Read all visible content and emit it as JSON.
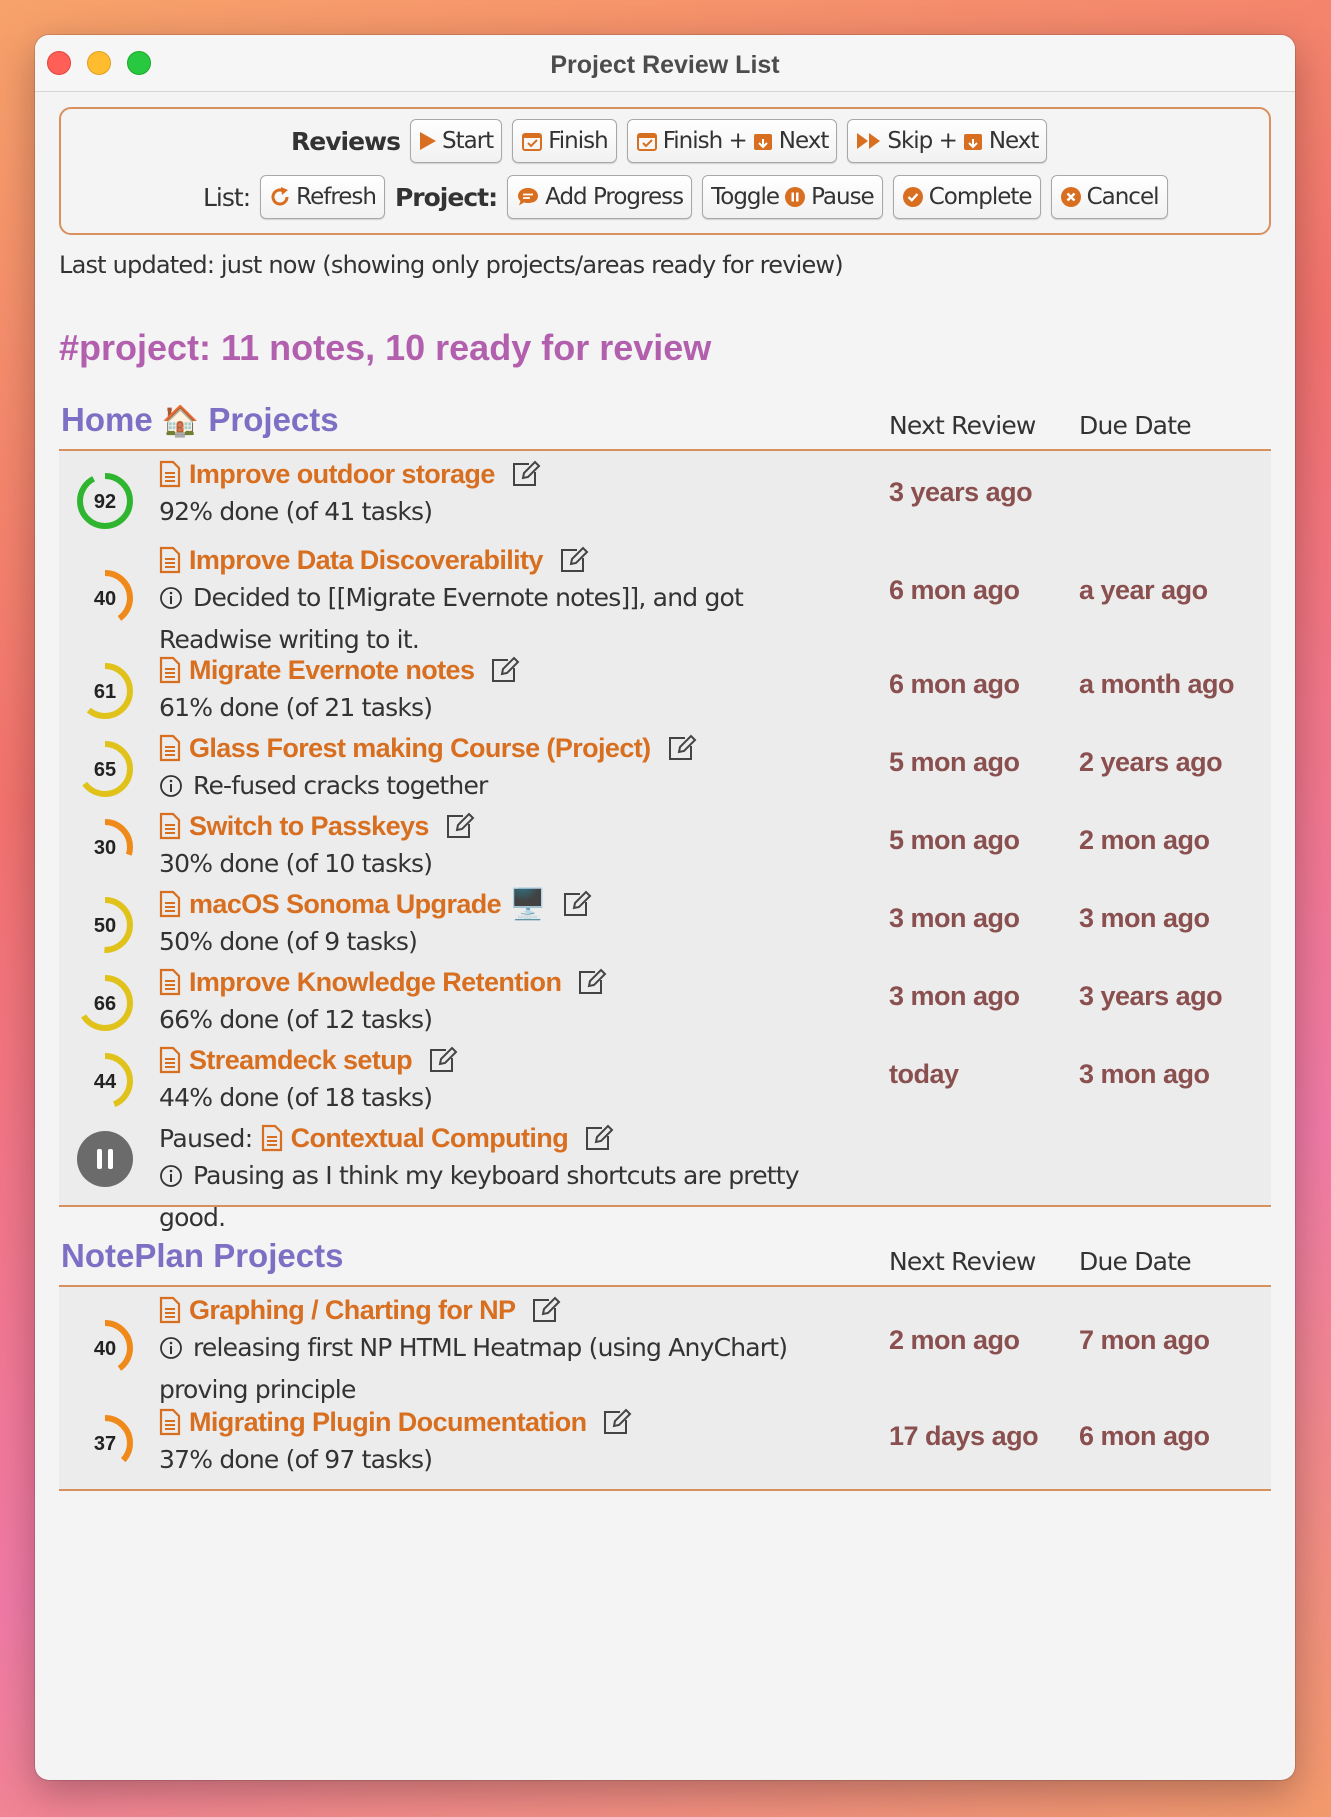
{
  "window": {
    "title": "Project Review List"
  },
  "toolbar": {
    "reviews_label": "Reviews",
    "list_label": "List:",
    "project_label": "Project:",
    "start": "Start",
    "finish": "Finish",
    "finish_next_a": "Finish +",
    "finish_next_b": "Next",
    "skip_next_a": "Skip +",
    "skip_next_b": "Next",
    "refresh": "Refresh",
    "add_progress": "Add Progress",
    "toggle_pause_a": "Toggle",
    "toggle_pause_b": "Pause",
    "complete": "Complete",
    "cancel": "Cancel"
  },
  "meta": {
    "last_updated": "Last updated: just now (showing only projects/areas ready for review)"
  },
  "summary": "#project: 11 notes, 10 ready for review",
  "columns": {
    "next_review": "Next Review",
    "due_date": "Due Date"
  },
  "sections": [
    {
      "title_a": "Home",
      "title_emoji": "🏠",
      "title_b": "Projects",
      "projects": [
        {
          "percent": "92",
          "title": "Improve outdoor storage",
          "detail": "92% done (of 41 tasks)",
          "info": false,
          "next_review": "3 years ago",
          "due": ""
        },
        {
          "percent": "40",
          "title": "Improve Data Discoverability",
          "detail": "Decided to [[Migrate Evernote notes]], and got Readwise writing to it.",
          "info": true,
          "next_review": "6 mon ago",
          "due": "a year ago"
        },
        {
          "percent": "61",
          "title": "Migrate Evernote notes",
          "detail": "61% done (of 21 tasks)",
          "info": false,
          "next_review": "6 mon ago",
          "due": "a month ago"
        },
        {
          "percent": "65",
          "title": "Glass Forest making Course (Project)",
          "detail": "Re-fused cracks together",
          "info": true,
          "next_review": "5 mon ago",
          "due": "2 years ago"
        },
        {
          "percent": "30",
          "title": "Switch to Passkeys",
          "detail": "30% done (of 10 tasks)",
          "info": false,
          "next_review": "5 mon ago",
          "due": "2 mon ago"
        },
        {
          "percent": "50",
          "title": "macOS Sonoma Upgrade",
          "emoji": "🖥️",
          "detail": "50% done (of 9 tasks)",
          "info": false,
          "next_review": "3 mon ago",
          "due": "3 mon ago"
        },
        {
          "percent": "66",
          "title": "Improve Knowledge Retention",
          "detail": "66% done (of 12 tasks)",
          "info": false,
          "next_review": "3 mon ago",
          "due": "3 years ago"
        },
        {
          "percent": "44",
          "title": "Streamdeck setup",
          "detail": "44% done (of 18 tasks)",
          "info": false,
          "next_review": "today",
          "due": "3 mon ago"
        },
        {
          "paused_label": "Paused:",
          "title": "Contextual Computing",
          "detail": "Pausing as I think my keyboard shortcuts are pretty good.",
          "info": true,
          "next_review": "",
          "due": ""
        }
      ]
    },
    {
      "title_a": "NotePlan Projects",
      "projects": [
        {
          "percent": "40",
          "title": "Graphing / Charting for NP",
          "detail": "releasing first NP HTML Heatmap (using AnyChart) proving principle",
          "info": true,
          "next_review": "2 mon ago",
          "due": "7 mon ago"
        },
        {
          "percent": "37",
          "title": "Migrating Plugin Documentation",
          "detail": "37% done (of 97 tasks)",
          "info": false,
          "next_review": "17 days ago",
          "due": "6 mon ago"
        }
      ]
    }
  ],
  "colors": {
    "accent_orange": "#d86f20",
    "date_red": "#8a4f4f",
    "section_purple": "#7d70c4",
    "summary_magenta": "#b25fae",
    "ring_green": "#2fb52f",
    "ring_yellow": "#e0c21a",
    "ring_orange": "#ef8a1a",
    "paused_grey": "#6b6b6b"
  }
}
